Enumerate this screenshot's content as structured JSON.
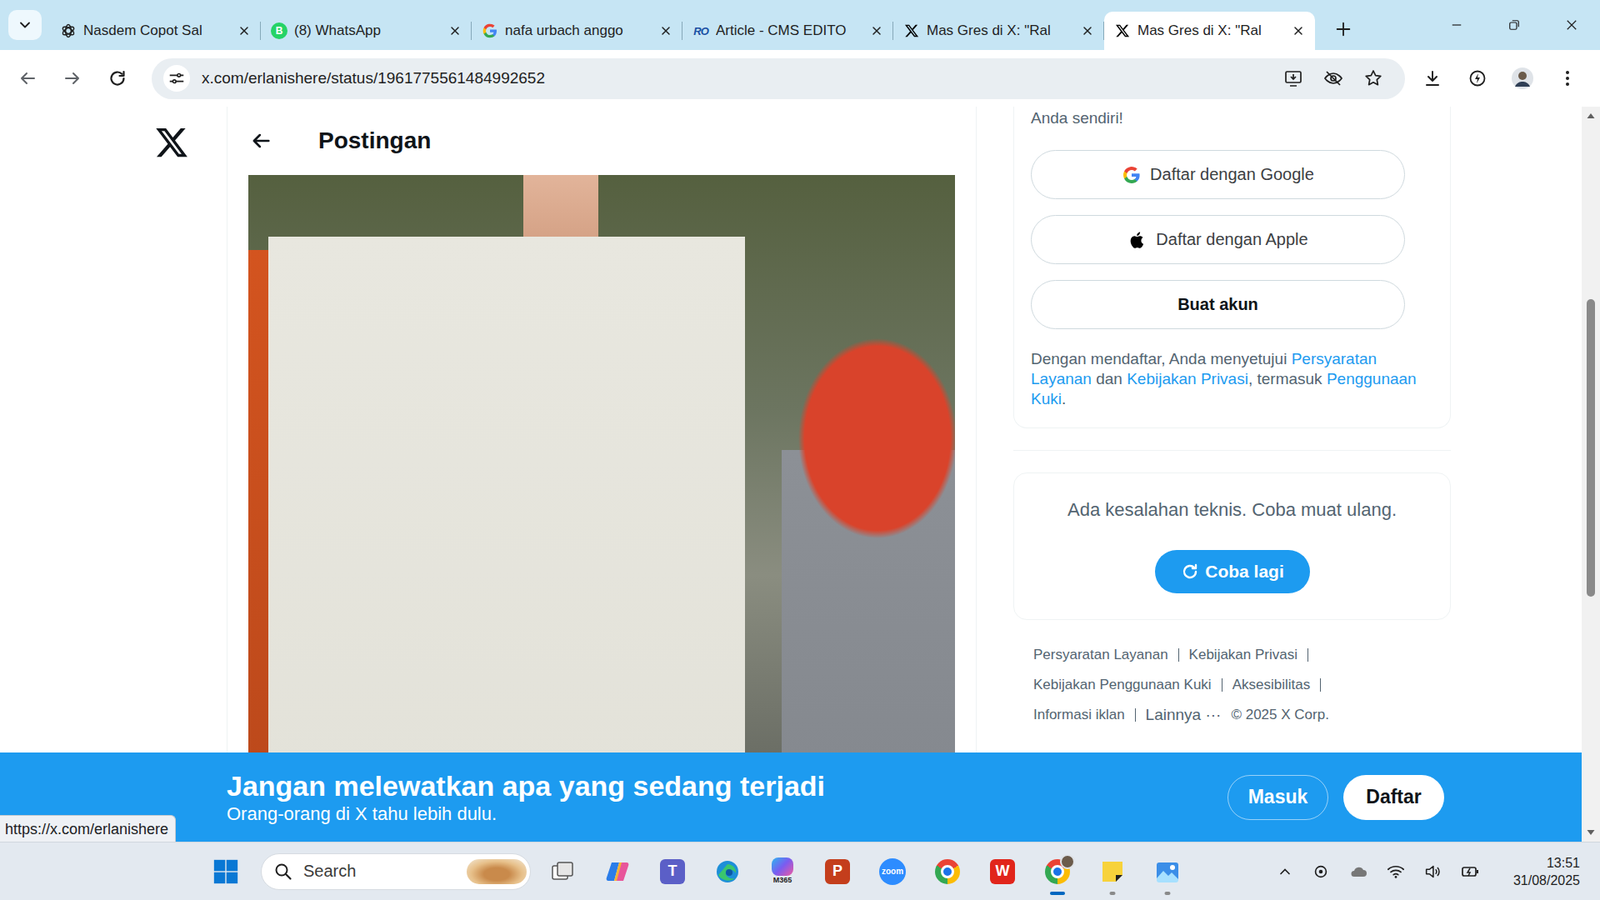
{
  "browser": {
    "tabs": [
      {
        "title": "Nasdem Copot Sal",
        "kind": "chatgpt",
        "selected": false
      },
      {
        "title": "(8) WhatsApp",
        "kind": "whatsapp",
        "logo_text": "B",
        "selected": false
      },
      {
        "title": "nafa urbach anggo",
        "kind": "google",
        "selected": false
      },
      {
        "title": "Article - CMS EDITO",
        "kind": "cms",
        "logo_text": "RO",
        "selected": false
      },
      {
        "title": "Mas Gres di X: \"Ral",
        "kind": "x",
        "selected": false
      },
      {
        "title": "Mas Gres di X: \"Ral",
        "kind": "x",
        "selected": true
      }
    ],
    "address": "x.com/erlanishere/status/1961775561484992652",
    "status_link": "https://x.com/erlanishere"
  },
  "page": {
    "header": {
      "title": "Postingan"
    },
    "sidebar": {
      "signup_tail": "Anda sendiri!",
      "buttons": [
        {
          "label": "Daftar dengan Google",
          "kind": "google"
        },
        {
          "label": "Daftar dengan Apple",
          "kind": "apple"
        },
        {
          "label": "Buat akun",
          "kind": "plain"
        }
      ],
      "terms": [
        {
          "text": "Dengan mendaftar, Anda menyetujui ",
          "link": false
        },
        {
          "text": "Persyaratan Layanan",
          "link": true
        },
        {
          "text": " dan ",
          "link": false
        },
        {
          "text": "Kebijakan Privasi",
          "link": true
        },
        {
          "text": ", termasuk ",
          "link": false
        },
        {
          "text": "Penggunaan Kuki",
          "link": true
        },
        {
          "text": ".",
          "link": false
        }
      ]
    },
    "error": {
      "message": "Ada kesalahan teknis. Coba muat ulang.",
      "button": "Coba lagi"
    },
    "footer": {
      "links": [
        "Persyaratan Layanan",
        "Kebijakan Privasi",
        "Kebijakan Penggunaan Kuki",
        "Aksesibilitas",
        "Informasi iklan"
      ],
      "more": "Lainnya ···",
      "copyright": "© 2025 X Corp."
    }
  },
  "banner": {
    "title": "Jangan melewatkan apa yang sedang terjadi",
    "subtitle": "Orang-orang di X tahu lebih dulu.",
    "buttons": [
      {
        "label": "Masuk",
        "kind": "outline"
      },
      {
        "label": "Daftar",
        "kind": "filled"
      }
    ]
  },
  "taskbar": {
    "search_placeholder": "Search",
    "apps": [
      {
        "kind": "taskview",
        "running": false,
        "active": false
      },
      {
        "kind": "copilot",
        "running": false,
        "active": false
      },
      {
        "kind": "teams",
        "glyph": "T",
        "running": false,
        "active": false
      },
      {
        "kind": "edge",
        "running": false,
        "active": false
      },
      {
        "kind": "m365",
        "glyph": "M365",
        "running": false,
        "active": false
      },
      {
        "kind": "powerpoint",
        "glyph": "P",
        "running": false,
        "active": false
      },
      {
        "kind": "zoom",
        "glyph": "zoom",
        "running": false,
        "active": false
      },
      {
        "kind": "chrome",
        "running": false,
        "active": false
      },
      {
        "kind": "wps",
        "glyph": "W",
        "running": false,
        "active": false
      },
      {
        "kind": "chrome-profile",
        "running": true,
        "active": true
      },
      {
        "kind": "sticky",
        "running": true,
        "active": false
      },
      {
        "kind": "photos",
        "running": true,
        "active": false
      }
    ],
    "time": "13:51",
    "date": "31/08/2025"
  }
}
